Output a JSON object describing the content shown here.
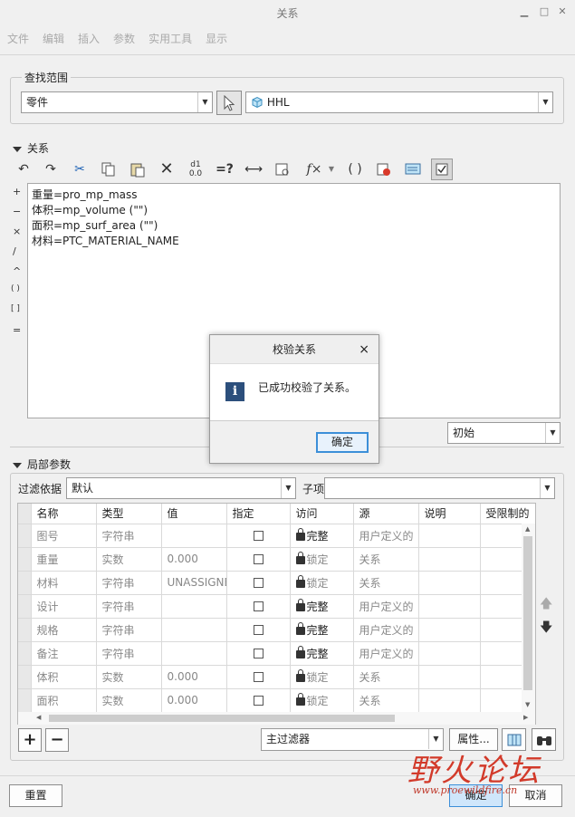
{
  "window": {
    "title": "关系",
    "min_icon": "minimize-icon",
    "max_icon": "maximize-icon",
    "close_icon": "close-icon"
  },
  "menu": [
    "文件",
    "编辑",
    "插入",
    "参数",
    "实用工具",
    "显示"
  ],
  "find_scope": {
    "label": "查找范围",
    "type_value": "零件",
    "model_value": "HHL"
  },
  "relations": {
    "label": "关系",
    "lines": [
      "重量=pro_mp_mass",
      "体积=mp_volume (\"\")",
      "面积=mp_surf_area (\"\")",
      "材料=PTC_MATERIAL_NAME"
    ],
    "side_symbols": [
      "+",
      "−",
      "×",
      "/",
      "^",
      "( )",
      "[ ]",
      "="
    ],
    "units_value": "初始",
    "toolbar": {
      "eq_label": "=?",
      "fx_label": "f×",
      "brackets_label": "( )"
    }
  },
  "local_params": {
    "label": "局部参数",
    "filter_label": "过滤依据",
    "filter_value": "默认",
    "child_label": "子项",
    "child_value": "",
    "columns": [
      "名称",
      "类型",
      "值",
      "指定",
      "访问",
      "源",
      "说明",
      "受限制的"
    ],
    "rows": [
      {
        "name": "图号",
        "type": "字符串",
        "value": "",
        "access": "完整",
        "source": "用户定义的",
        "access_kind": "full"
      },
      {
        "name": "重量",
        "type": "实数",
        "value": "0.000",
        "access": "锁定",
        "source": "关系",
        "access_kind": "locked"
      },
      {
        "name": "材料",
        "type": "字符串",
        "value": "UNASSIGNED",
        "access": "锁定",
        "source": "关系",
        "access_kind": "locked"
      },
      {
        "name": "设计",
        "type": "字符串",
        "value": "",
        "access": "完整",
        "source": "用户定义的",
        "access_kind": "full"
      },
      {
        "name": "规格",
        "type": "字符串",
        "value": "",
        "access": "完整",
        "source": "用户定义的",
        "access_kind": "full"
      },
      {
        "name": "备注",
        "type": "字符串",
        "value": "",
        "access": "完整",
        "source": "用户定义的",
        "access_kind": "full"
      },
      {
        "name": "体积",
        "type": "实数",
        "value": "0.000",
        "access": "锁定",
        "source": "关系",
        "access_kind": "locked"
      },
      {
        "name": "面积",
        "type": "实数",
        "value": "0.000",
        "access": "锁定",
        "source": "关系",
        "access_kind": "locked"
      }
    ],
    "main_filter": "主过滤器",
    "props_button": "属性...",
    "add_label": "+",
    "remove_label": "−"
  },
  "footer": {
    "reset": "重置",
    "ok": "确定",
    "cancel": "取消"
  },
  "dialog": {
    "title": "校验关系",
    "message": "已成功校验了关系。",
    "ok": "确定",
    "icon": "info-icon",
    "close": "×"
  },
  "watermark": {
    "text": "野火论坛",
    "url": "www.proewildfire.cn"
  }
}
